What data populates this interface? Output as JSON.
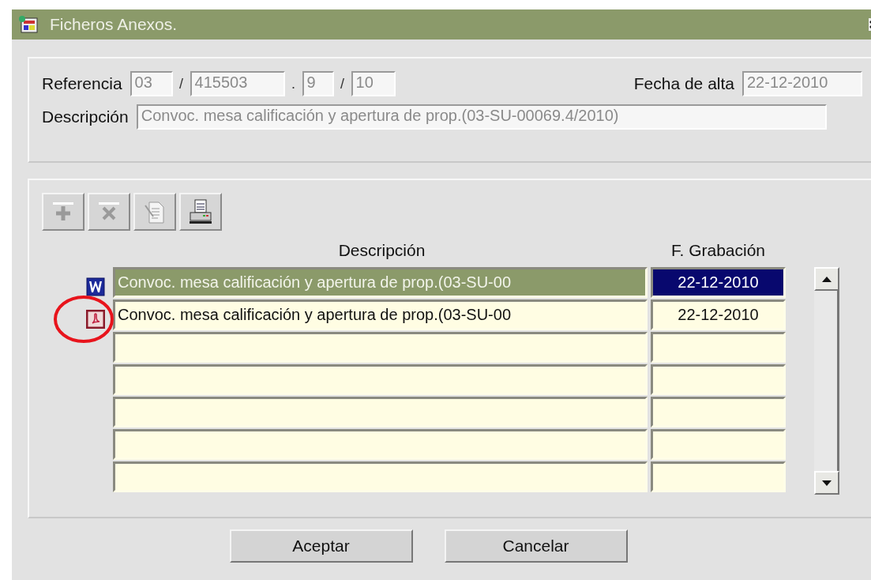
{
  "window": {
    "title": "Ficheros Anexos."
  },
  "header": {
    "referencia_label": "Referencia",
    "referencia": [
      "03",
      "415503",
      "9",
      "10"
    ],
    "separators": [
      "/",
      ".",
      "/"
    ],
    "fecha_alta_label": "Fecha de alta",
    "fecha_alta": "22-12-2010",
    "descripcion_label": "Descripción",
    "descripcion": "Convoc. mesa calificación y apertura de prop.(03-SU-00069.4/2010)"
  },
  "toolbar": [
    {
      "kind": "add",
      "disabled": true
    },
    {
      "kind": "delete",
      "disabled": true
    },
    {
      "kind": "edit",
      "disabled": true
    },
    {
      "kind": "print",
      "disabled": false
    }
  ],
  "table": {
    "columns": [
      "Descripción",
      "F. Grabación"
    ],
    "rows": [
      {
        "kind": "word",
        "selected": true,
        "descripcion": "Convoc. mesa calificación y apertura de prop.(03-SU-00",
        "fecha": "22-12-2010",
        "circled": false
      },
      {
        "kind": "acrobat",
        "selected": false,
        "descripcion": "Convoc. mesa calificación y apertura de prop.(03-SU-00",
        "fecha": "22-12-2010",
        "circled": true
      }
    ]
  },
  "buttons": [
    "Aceptar",
    "Cancelar"
  ]
}
